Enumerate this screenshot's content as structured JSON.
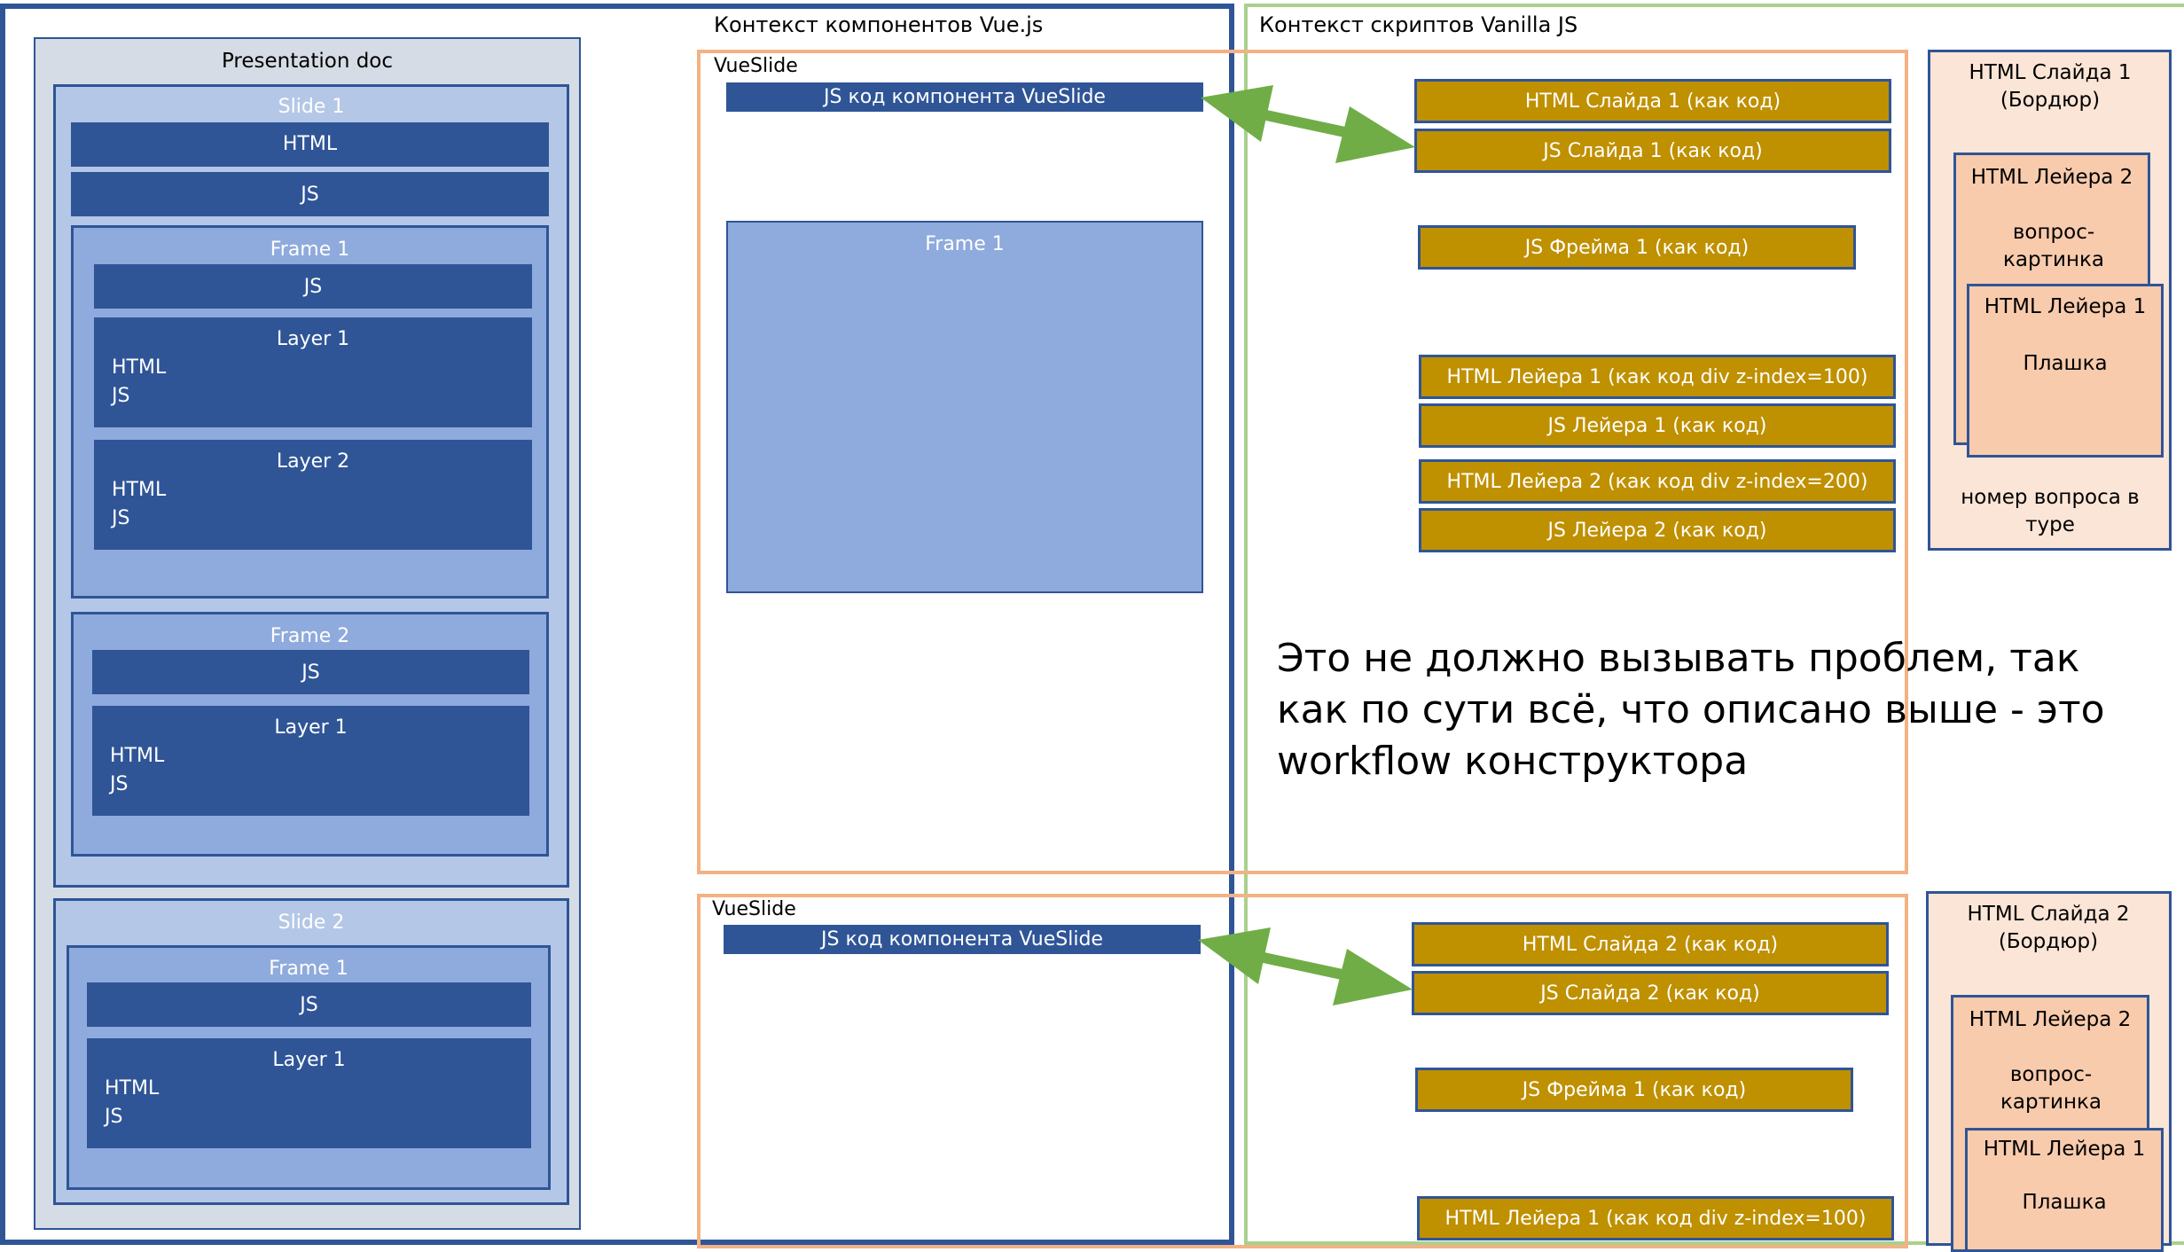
{
  "contexts": {
    "vue_title": "Контекст компонентов Vue.js",
    "vanilla_title": "Контекст скриптов Vanilla JS"
  },
  "doc": {
    "title": "Presentation doc",
    "slide1": {
      "title": "Slide 1",
      "html": "HTML",
      "js": "JS",
      "frame1": {
        "title": "Frame 1",
        "js": "JS",
        "layer1": {
          "title": "Layer 1",
          "html": "HTML",
          "js": "JS"
        },
        "layer2": {
          "title": "Layer 2",
          "html": "HTML",
          "js": "JS"
        }
      },
      "frame2": {
        "title": "Frame 2",
        "js": "JS",
        "layer1": {
          "title": "Layer 1",
          "html": "HTML",
          "js": "JS"
        }
      }
    },
    "slide2": {
      "title": "Slide 2",
      "frame1": {
        "title": "Frame 1",
        "js": "JS",
        "layer1": {
          "title": "Layer 1",
          "html": "HTML",
          "js": "JS"
        }
      }
    }
  },
  "vue1": {
    "label": "VueSlide",
    "bar": "JS код компонента VueSlide",
    "frame": "Frame 1"
  },
  "vue2": {
    "label": "VueSlide",
    "bar": "JS код компонента VueSlide"
  },
  "gold1": [
    "HTML Слайда 1  (как код)",
    "JS Слайда 1 (как код)",
    "JS Фрейма 1 (как код)",
    "HTML Лейера 1  (как код div z-index=100)",
    "JS Лейера 1 (как код)",
    "HTML Лейера 2  (как код div z-index=200)",
    "JS Лейера 2 (как код)"
  ],
  "gold2": [
    "HTML Слайда 2 (как код)",
    "JS Слайда 2 (как код)",
    "JS Фрейма 1 (как код)",
    "HTML Лейера 1  (как код div z-index=100)"
  ],
  "panel1": {
    "title": "HTML Слайда 1 (Бордюр)",
    "layer2_title": "HTML Лейера 2",
    "layer2_body": "вопрос-картинка",
    "layer1_title": "HTML Лейера 1",
    "layer1_body": "Плашка",
    "footer": "номер вопроса в туре"
  },
  "panel2": {
    "title": "HTML Слайда 2 (Бордюр)",
    "layer2_title": "HTML Лейера 2",
    "layer2_body": "вопрос-картинка",
    "layer1_title": "HTML Лейера 1",
    "layer1_body": "Плашка"
  },
  "note": "Это не должно вызывать проблем, так как по сути всё, что описано выше - это workflow конструктора",
  "colors": {
    "vue_border": "#2F5597",
    "vanilla_border": "#A9D18E",
    "vueslide_border": "#F4B183",
    "gold": "#BF9000",
    "arrow": "#70AD47"
  }
}
